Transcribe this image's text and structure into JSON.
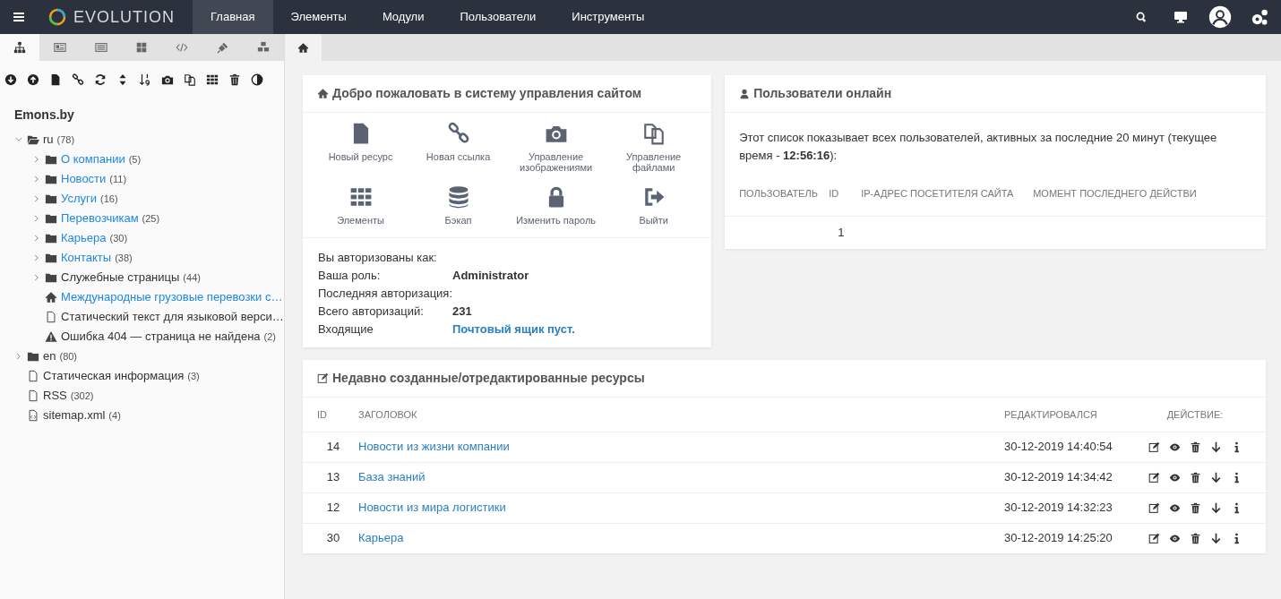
{
  "topbar": {
    "brand": "EVOLUTION",
    "menu": [
      {
        "label": "Главная",
        "selected": true
      },
      {
        "label": "Элементы",
        "selected": false
      },
      {
        "label": "Модули",
        "selected": false
      },
      {
        "label": "Пользователи",
        "selected": false
      },
      {
        "label": "Инструменты",
        "selected": false
      }
    ]
  },
  "sidebar": {
    "tabs": [
      {
        "selected": true
      },
      {
        "selected": false
      },
      {
        "selected": false
      },
      {
        "selected": false
      },
      {
        "selected": false
      },
      {
        "selected": false
      },
      {
        "selected": false
      }
    ],
    "site_name": "Emons.by",
    "tree": [
      {
        "label": "ru",
        "count": "(78)",
        "kind": "folder",
        "expanded": true,
        "color": "#333333",
        "children": [
          {
            "label": "О компании",
            "count": "(5)",
            "kind": "folder",
            "expanded": false,
            "color": "#1e88e5"
          },
          {
            "label": "Новости",
            "count": "(11)",
            "kind": "folder",
            "expanded": false,
            "color": "#1e88e5"
          },
          {
            "label": "Услуги",
            "count": "(16)",
            "kind": "folder",
            "expanded": false,
            "color": "#1e88e5"
          },
          {
            "label": "Перевозчикам",
            "count": "(25)",
            "kind": "folder",
            "expanded": false,
            "color": "#1e88e5"
          },
          {
            "label": "Карьера",
            "count": "(30)",
            "kind": "folder",
            "expanded": false,
            "color": "#1e88e5"
          },
          {
            "label": "Контакты",
            "count": "(38)",
            "kind": "folder",
            "expanded": false,
            "color": "#1e88e5"
          },
          {
            "label": "Служебные страницы",
            "count": "(44)",
            "kind": "folder",
            "expanded": false,
            "color": "#333333"
          },
          {
            "label": "Международные грузовые перевозки с…",
            "kind": "home",
            "color": "#1e88e5"
          },
          {
            "label": "Статический текст для языковой верси…",
            "kind": "page",
            "color": "#333333"
          },
          {
            "label": "Ошибка 404 — страница не найдена",
            "count": "(2)",
            "kind": "warning",
            "color": "#333333"
          }
        ]
      },
      {
        "label": "en",
        "count": "(80)",
        "kind": "folder",
        "expanded": false,
        "color": "#333333"
      },
      {
        "label": "Статическая информация",
        "count": "(3)",
        "kind": "page",
        "color": "#333333"
      },
      {
        "label": "RSS",
        "count": "(302)",
        "kind": "page",
        "color": "#333333"
      },
      {
        "label": "sitemap.xml",
        "count": "(4)",
        "kind": "code",
        "color": "#333333"
      }
    ]
  },
  "main_tabs": [
    {
      "selected": true
    }
  ],
  "welcome": {
    "title": "Добро пожаловать в систему управления сайтом",
    "actions": [
      "Новый ресурс",
      "Новая ссылка",
      "Управление изображениями",
      "Управление файлами",
      "Элементы",
      "Бэкап",
      "Изменить пароль",
      "Выйти"
    ],
    "info": [
      {
        "label": "Вы авторизованы как:"
      },
      {
        "label": "Ваша роль:",
        "value": "Administrator",
        "kind": "bold"
      },
      {
        "label": "Последняя авторизация:"
      },
      {
        "label": "Всего авторизаций:",
        "value": "231",
        "kind": "bold"
      },
      {
        "label": "Входящие",
        "value": "Почтовый ящик пуст.",
        "kind": "link"
      }
    ]
  },
  "online": {
    "title": "Пользователи онлайн",
    "description": "Этот список показывает всех пользователей, активных за последние 20 минут (текущее время - **12:56:16**):",
    "columns": [
      "ПОЛЬЗОВАТЕЛЬ",
      "ID",
      "IP-АДРЕС ПОСЕТИТЕЛЯ САЙТА",
      "МОМЕНТ ПОСЛЕДНЕГО ДЕЙСТВИ"
    ],
    "rows": [
      [
        "",
        "1",
        "",
        ""
      ]
    ]
  },
  "recent": {
    "title": "Недавно созданные/отредактированные ресурсы",
    "columns": [
      "ID",
      "ЗАГОЛОВОК",
      "РЕДАКТИРОВАЛСЯ",
      "ДЕЙСТВИЕ:"
    ],
    "rows": [
      {
        "id": "14",
        "title": "Новости из жизни компании",
        "edited": "30-12-2019 14:40:54"
      },
      {
        "id": "13",
        "title": "База знаний",
        "edited": "30-12-2019 14:34:42"
      },
      {
        "id": "12",
        "title": "Новости из мира логистики",
        "edited": "30-12-2019 14:32:23"
      },
      {
        "id": "30",
        "title": "Карьера",
        "edited": "30-12-2019 14:25:20"
      }
    ]
  }
}
